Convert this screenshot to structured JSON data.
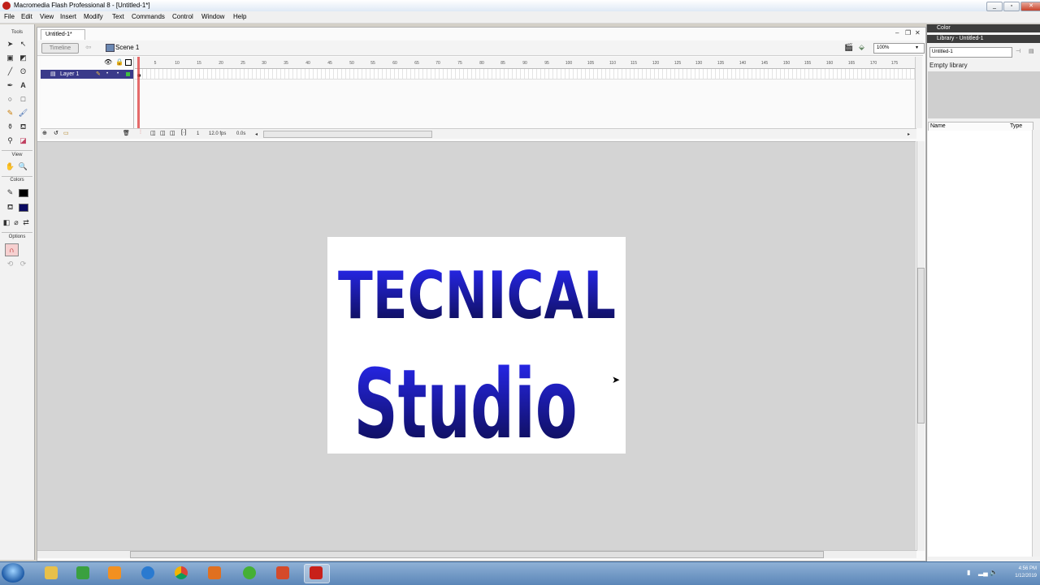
{
  "window": {
    "title": "Macromedia Flash Professional 8 - [Untitled-1*]"
  },
  "menubar": [
    "File",
    "Edit",
    "View",
    "Insert",
    "Modify",
    "Text",
    "Commands",
    "Control",
    "Window",
    "Help"
  ],
  "tools": {
    "title": "Tools",
    "view_label": "View",
    "colors_label": "Colors",
    "options_label": "Options"
  },
  "document": {
    "tab": "Untitled-1*",
    "timeline_button": "Timeline",
    "scene": "Scene 1",
    "zoom": "100%",
    "layer_name": "Layer 1",
    "ruler_ticks": [
      "5",
      "10",
      "15",
      "20",
      "25",
      "30",
      "35",
      "40",
      "45",
      "50",
      "55",
      "60",
      "65",
      "70",
      "75",
      "80",
      "85",
      "90",
      "95",
      "100",
      "105",
      "110",
      "115",
      "120",
      "125",
      "130",
      "135",
      "140",
      "145",
      "150",
      "155",
      "160",
      "165",
      "170",
      "175"
    ],
    "status": {
      "frame": "1",
      "fps": "12.0 fps",
      "time": "0.0s"
    },
    "stage_text": {
      "line1": "TECNICAL",
      "line2": "Studio"
    },
    "stage_colors": {
      "fill_light": "#2a2aff",
      "fill_dark": "#0a0a40"
    }
  },
  "panels": {
    "color_title": "Color",
    "library_title": "Library - Untitled-1",
    "library_select": "Untitled-1",
    "library_empty": "Empty library",
    "col_name": "Name",
    "col_type": "Type"
  },
  "taskbar": {
    "clock_time": "4:56 PM",
    "clock_date": "1/12/2019"
  }
}
